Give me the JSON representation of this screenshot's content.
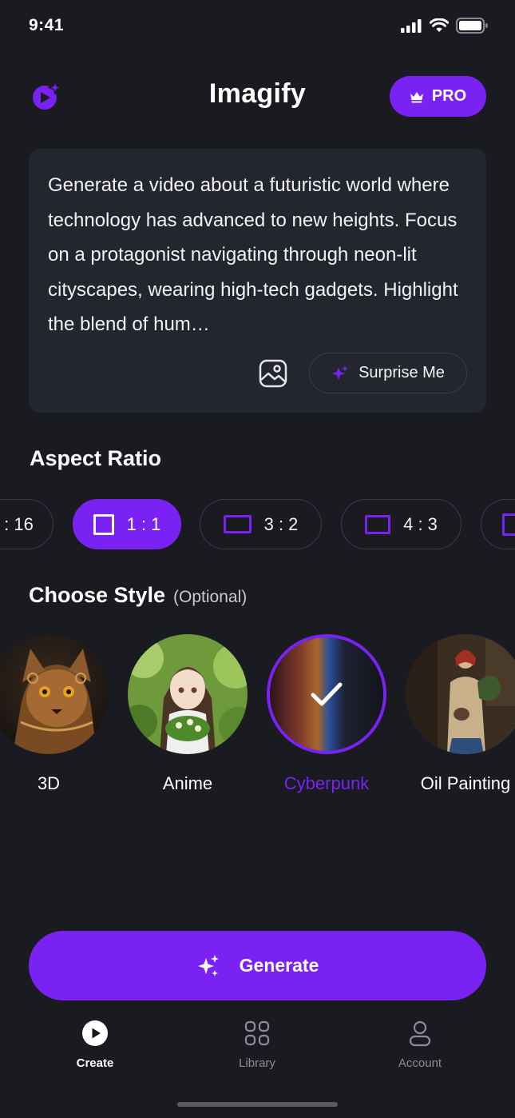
{
  "status_bar": {
    "time": "9:41"
  },
  "header": {
    "title": "Imagify",
    "pro_label": "PRO"
  },
  "prompt": {
    "text": "Generate a video about a futuristic world where technology has advanced to new heights. Focus on a protagonist navigating through neon-lit cityscapes, wearing high-tech gadgets. Highlight the blend of hum…",
    "surprise_label": "Surprise Me"
  },
  "aspect_ratio": {
    "title": "Aspect Ratio",
    "options": [
      {
        "label": ": 16",
        "selected": false
      },
      {
        "label": "1 : 1",
        "selected": true
      },
      {
        "label": "3 : 2",
        "selected": false
      },
      {
        "label": "4 : 3",
        "selected": false
      }
    ]
  },
  "style": {
    "title": "Choose Style",
    "optional": "(Optional)",
    "items": [
      {
        "label": "3D",
        "selected": false
      },
      {
        "label": "Anime",
        "selected": false
      },
      {
        "label": "Cyberpunk",
        "selected": true
      },
      {
        "label": "Oil Painting",
        "selected": false
      }
    ]
  },
  "generate": {
    "label": "Generate"
  },
  "tabs": [
    {
      "label": "Create",
      "icon": "play-circle-icon",
      "active": true
    },
    {
      "label": "Library",
      "icon": "grid-icon",
      "active": false
    },
    {
      "label": "Account",
      "icon": "user-icon",
      "active": false
    }
  ],
  "colors": {
    "accent": "#7a22f4",
    "background": "#1a1b20",
    "card": "#24262d"
  }
}
